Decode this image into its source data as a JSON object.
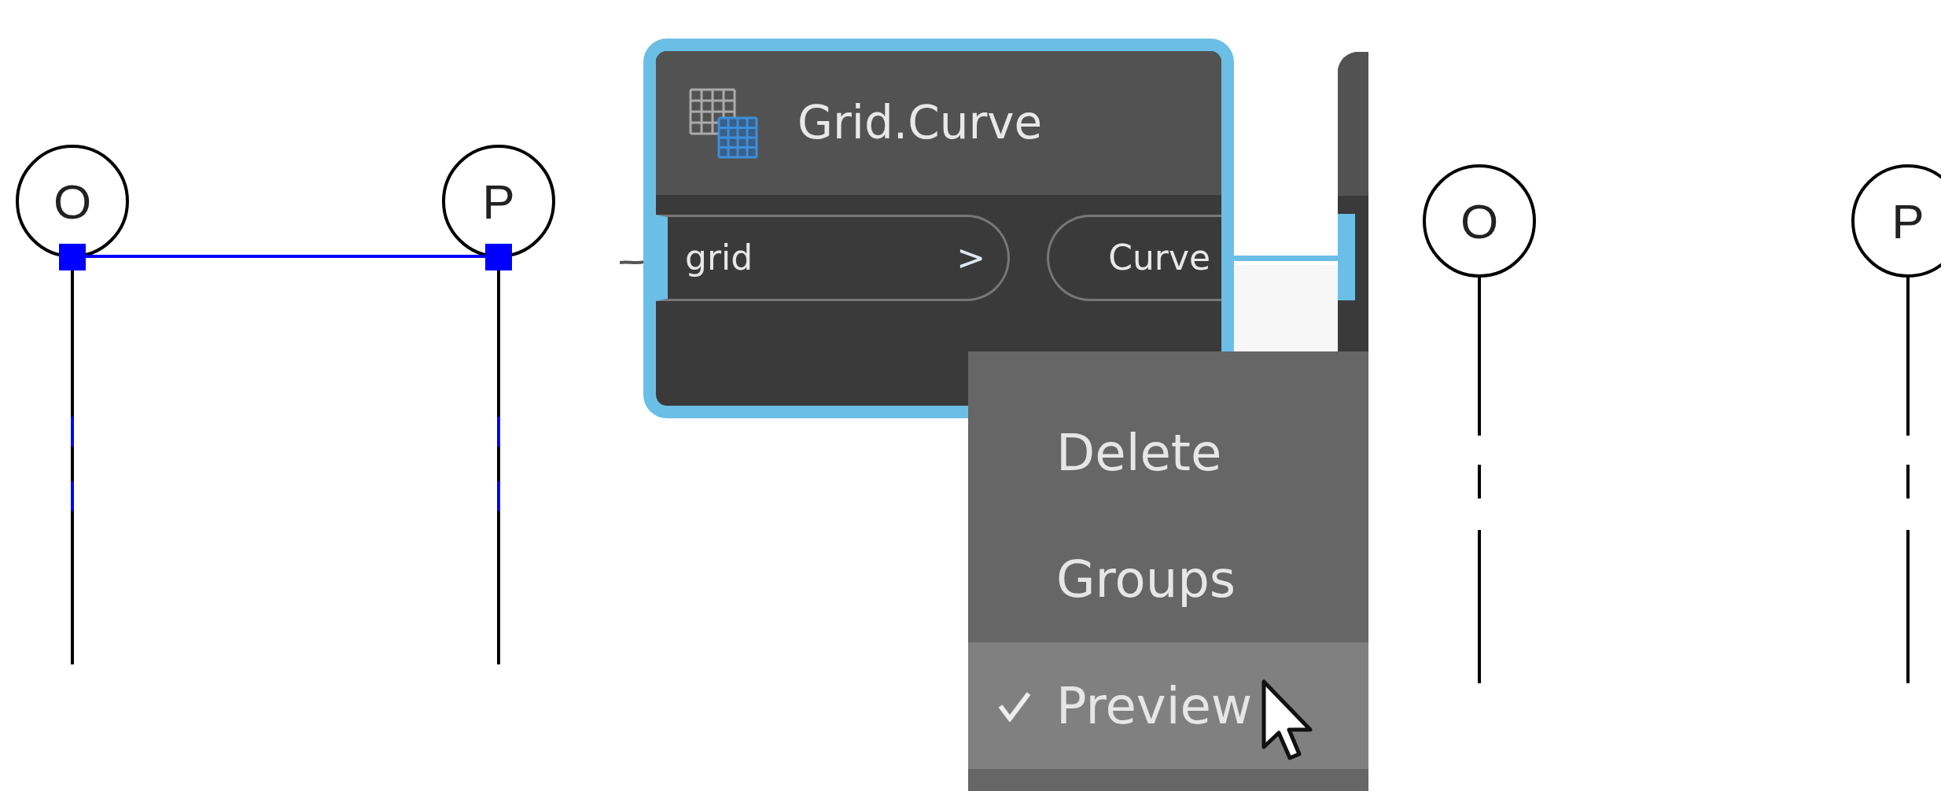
{
  "left_view": {
    "grids": [
      {
        "label": "O",
        "selected": true
      },
      {
        "label": "P",
        "selected": true
      }
    ]
  },
  "node": {
    "title": "Grid.Curve",
    "selected": true,
    "inputs": [
      {
        "name": "grid",
        "arrow": ">"
      }
    ],
    "outputs": [
      {
        "name": "Curve"
      }
    ]
  },
  "context_menu": {
    "items": [
      {
        "label": "Delete",
        "checked": false,
        "selected": false
      },
      {
        "label": "Groups",
        "checked": false,
        "selected": false
      },
      {
        "label": "Preview",
        "checked": true,
        "selected": true
      }
    ]
  },
  "right_view": {
    "grids": [
      {
        "label": "O",
        "selected": false
      },
      {
        "label": "P",
        "selected": false
      }
    ]
  }
}
